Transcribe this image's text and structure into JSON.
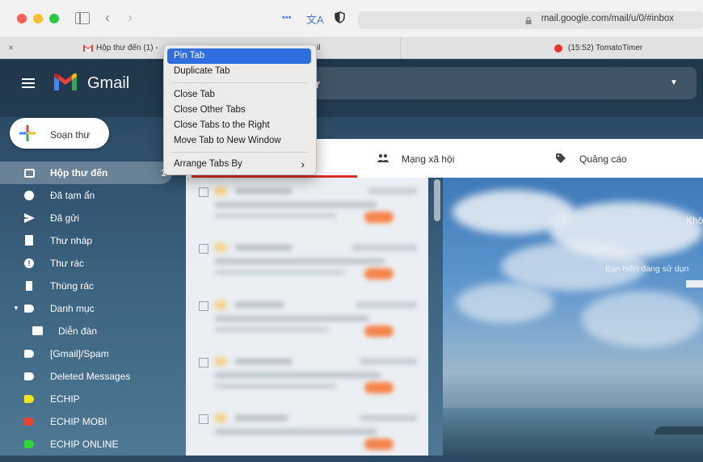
{
  "browser": {
    "url": "mail.google.com/mail/u/0/#inbox",
    "reader_icon": "•••",
    "translate_icon": "文A",
    "tabs": [
      {
        "close": "×",
        "label": "Hộp thư đến (1) -"
      },
      {
        "label": "il"
      },
      {
        "label": "(15:52) TomatoTimer"
      }
    ]
  },
  "context_menu": {
    "items": [
      {
        "label": "Pin Tab"
      },
      {
        "label": "Duplicate Tab"
      },
      {
        "label": "Close Tab"
      },
      {
        "label": "Close Other Tabs"
      },
      {
        "label": "Close Tabs to the Right"
      },
      {
        "label": "Move Tab to New Window"
      },
      {
        "label": "Arrange Tabs By",
        "arrow": "›"
      }
    ]
  },
  "gmail": {
    "app_name": "Gmail",
    "compose_label": "Soạn thư",
    "search_fragment": "ư",
    "categories": [
      {
        "label": "Mạng xã hội"
      },
      {
        "label": "Quảng cáo"
      }
    ],
    "nav_items": [
      {
        "label": "Hộp thư đến",
        "count": "1",
        "icon": "inbox-icon"
      },
      {
        "label": "Đã tạm ẩn",
        "icon": "clock-icon"
      },
      {
        "label": "Đã gửi",
        "icon": "send-icon"
      },
      {
        "label": "Thư nháp",
        "icon": "draft-icon"
      },
      {
        "label": "Thư rác",
        "icon": "spam-icon"
      },
      {
        "label": "Thùng rác",
        "icon": "trash-icon"
      },
      {
        "label": "Danh mục",
        "icon": "label-icon"
      },
      {
        "label": "Diễn đàn",
        "icon": "forum-icon"
      },
      {
        "label": "[Gmail]/Spam",
        "icon": "label-icon"
      },
      {
        "label": "Deleted Messages",
        "icon": "label-icon"
      },
      {
        "label": "ECHIP",
        "icon": "label-icon",
        "color": "#f6e21d"
      },
      {
        "label": "ECHIP MOBI",
        "icon": "label-icon",
        "color": "#e8412f"
      },
      {
        "label": "ECHIP ONLINE",
        "icon": "label-icon",
        "color": "#2ed636"
      }
    ],
    "theme_text": {
      "line1": "Khô",
      "line2": "Bạn hiện đang sử dụn"
    }
  }
}
